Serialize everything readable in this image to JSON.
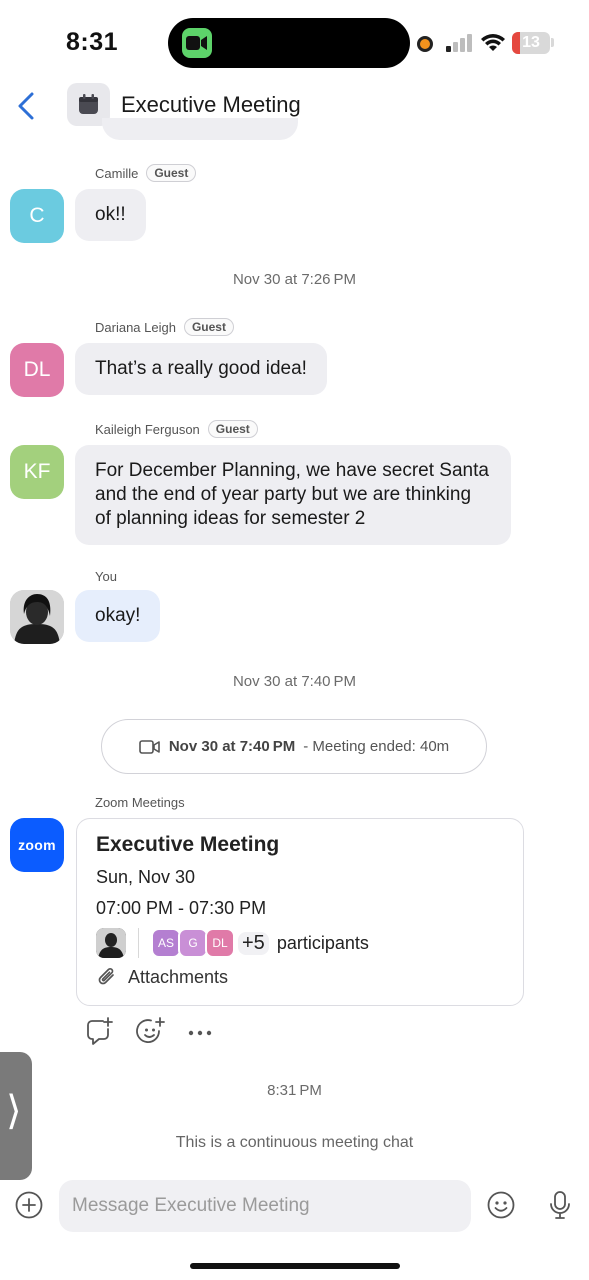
{
  "status_bar": {
    "time": "8:31",
    "battery": "13"
  },
  "header": {
    "title": "Executive Meeting"
  },
  "messages": [
    {
      "sender": "Camille",
      "badge": "Guest",
      "initials": "C",
      "avatar_color": "#6bcbe0",
      "text": "ok!!"
    },
    {
      "sender": "Dariana Leigh",
      "badge": "Guest",
      "initials": "DL",
      "avatar_color": "#e07aa8",
      "text": "That’s a really good idea!"
    },
    {
      "sender": "Kaileigh Ferguson",
      "badge": "Guest",
      "initials": "KF",
      "avatar_color": "#a3d07d",
      "text": "For December Planning, we have secret Santa and the end of year party but we are thinking of planning ideas for semester 2"
    },
    {
      "sender": "You",
      "text": "okay!"
    }
  ],
  "timestamps": {
    "t1": "Nov 30 at 7:26 PM",
    "t2": "Nov 30 at 7:40 PM",
    "t3": "8:31 PM"
  },
  "meeting_pill": {
    "time": "Nov 30 at 7:40 PM",
    "status": "- Meeting ended: 40m"
  },
  "zoom_card": {
    "sender": "Zoom Meetings",
    "avatar_text": "zoom",
    "title": "Executive Meeting",
    "date": "Sun, Nov 30",
    "time_range": "07:00 PM - 07:30 PM",
    "participants": [
      {
        "initials": "AS",
        "color": "#b47fd1"
      },
      {
        "initials": "G",
        "color": "#c98fd6"
      },
      {
        "initials": "DL",
        "color": "#e07aa8"
      }
    ],
    "more_count": "+5",
    "participants_label": "participants",
    "attachments_label": "Attachments"
  },
  "continuous_note": "This is a continuous meeting chat",
  "composer": {
    "placeholder": "Message Executive Meeting"
  },
  "icons": {
    "back": "chevron-left-icon",
    "channel": "calendar-icon",
    "video": "video-camera-icon",
    "reply": "reply-icon",
    "react": "add-reaction-icon",
    "more": "more-icon",
    "add": "plus-circle-icon",
    "emoji": "emoji-icon",
    "mic": "microphone-icon",
    "attach": "paperclip-icon"
  },
  "colors": {
    "accent": "#0b5cff",
    "bubble": "#eeeef2",
    "my_bubble": "#e6eefc"
  }
}
